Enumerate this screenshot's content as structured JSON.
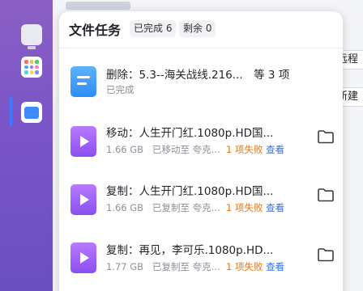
{
  "dock": {
    "items": [
      {
        "name": "monitor"
      },
      {
        "name": "apps"
      },
      {
        "name": "file-manager",
        "active": true
      }
    ],
    "accent": "#3c7bff"
  },
  "background_app": {
    "remote_label": "远程",
    "new_label": "新建"
  },
  "panel": {
    "title": "文件任务",
    "completed_chip": "已完成 6",
    "remaining_chip": "剩余 0"
  },
  "tasks": [
    {
      "icon": "document-icon",
      "name": "删除：5.3--海关战线.216...　等 3 项",
      "status": "已完成"
    },
    {
      "icon": "video-icon",
      "name": "移动：人生开门红.1080p.HD国...",
      "size": "1.66 GB",
      "detail": "已移动至 夸克...",
      "fail": "1 项失败",
      "view": "查看"
    },
    {
      "icon": "video-icon",
      "name": "复制：人生开门红.1080p.HD国...",
      "size": "1.66 GB",
      "detail": "已复制至 夸克...",
      "fail": "1 项失败",
      "view": "查看"
    },
    {
      "icon": "video-icon",
      "name": "复制：再见，李可乐.1080p.HD...",
      "size": "1.77 GB",
      "detail": "已复制至 夸克...",
      "fail": "1 项失败",
      "view": "查看"
    }
  ],
  "colors": {
    "fail": "#e8740c",
    "link": "#2f6fed",
    "dock": "#7a55c8"
  }
}
